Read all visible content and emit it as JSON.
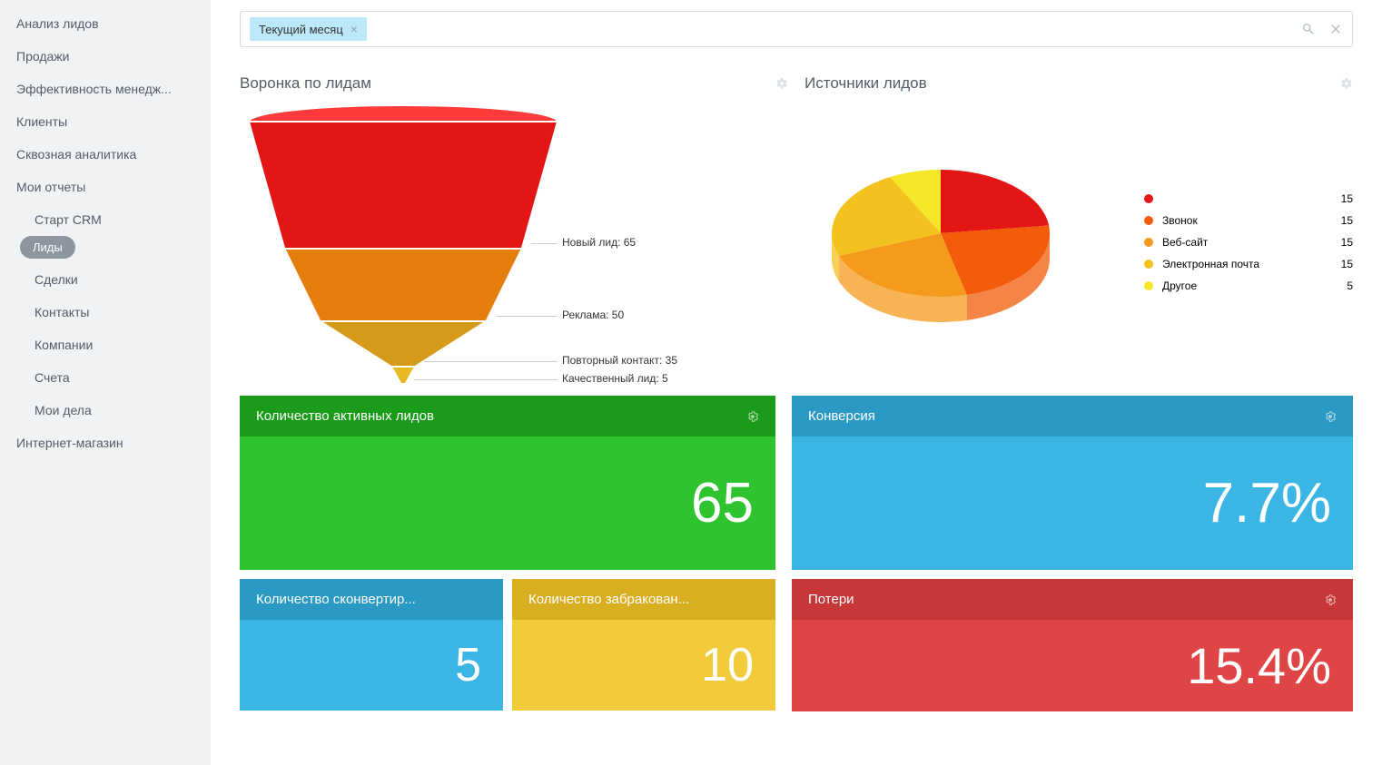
{
  "sidebar": {
    "items": [
      {
        "label": "Анализ лидов",
        "sub": false
      },
      {
        "label": "Продажи",
        "sub": false
      },
      {
        "label": "Эффективность менедж...",
        "sub": false
      },
      {
        "label": "Клиенты",
        "sub": false
      },
      {
        "label": "Сквозная аналитика",
        "sub": false
      },
      {
        "label": "Мои отчеты",
        "sub": false
      },
      {
        "label": "Старт CRM",
        "sub": true
      },
      {
        "label": "Лиды",
        "sub": true,
        "active": true
      },
      {
        "label": "Сделки",
        "sub": true
      },
      {
        "label": "Контакты",
        "sub": true
      },
      {
        "label": "Компании",
        "sub": true
      },
      {
        "label": "Счета",
        "sub": true
      },
      {
        "label": "Мои дела",
        "sub": true
      },
      {
        "label": "Интернет-магазин",
        "sub": false
      }
    ]
  },
  "filter": {
    "tag": "Текущий месяц"
  },
  "funnel": {
    "title": "Воронка по лидам"
  },
  "pie": {
    "title": "Источники лидов"
  },
  "cards": {
    "active": {
      "title": "Количество активных лидов",
      "value": "65"
    },
    "converted": {
      "title": "Количество сконвертир...",
      "value": "5"
    },
    "rejected": {
      "title": "Количество забракован...",
      "value": "10"
    },
    "conversion": {
      "title": "Конверсия",
      "value": "7.7%"
    },
    "loss": {
      "title": "Потери",
      "value": "15.4%"
    }
  },
  "chart_data": [
    {
      "type": "funnel",
      "title": "Воронка по лидам",
      "stages": [
        {
          "name": "Новый лид",
          "value": 65,
          "color": "#e31515"
        },
        {
          "name": "Реклама",
          "value": 50,
          "color": "#e67e0e"
        },
        {
          "name": "Повторный контакт",
          "value": 35,
          "color": "#d69a1a"
        },
        {
          "name": "Качественный лид",
          "value": 5,
          "color": "#e8b923"
        }
      ]
    },
    {
      "type": "pie",
      "title": "Источники лидов",
      "series": [
        {
          "name": "",
          "value": 15,
          "color": "#e31515"
        },
        {
          "name": "Звонок",
          "value": 15,
          "color": "#f25c0a"
        },
        {
          "name": "Веб-сайт",
          "value": 15,
          "color": "#f59a1c"
        },
        {
          "name": "Электронная почта",
          "value": 15,
          "color": "#f3c21e"
        },
        {
          "name": "Другое",
          "value": 5,
          "color": "#f5e627"
        }
      ]
    }
  ]
}
